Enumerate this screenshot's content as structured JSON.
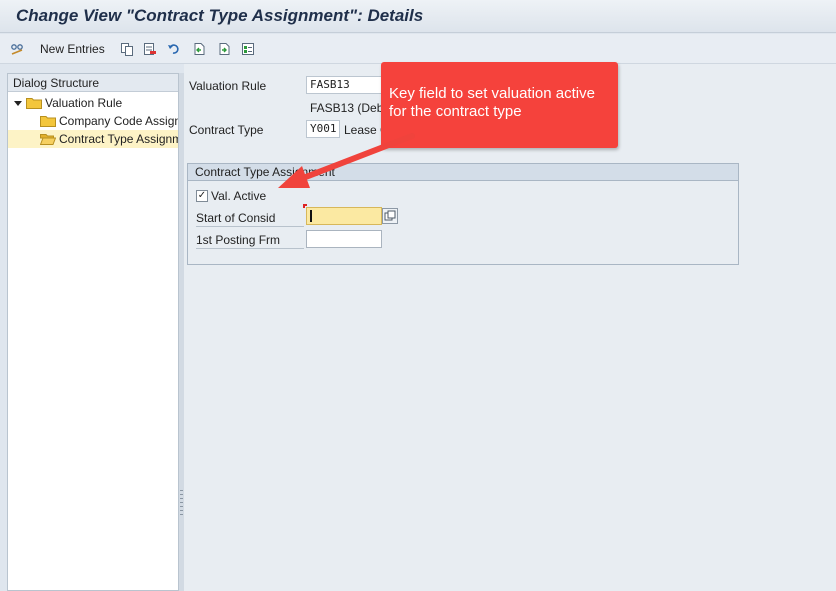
{
  "window": {
    "title": "Change View \"Contract Type Assignment\": Details"
  },
  "toolbar": {
    "new_entries_label": "New Entries",
    "icons": [
      "display-change-icon",
      "copy-icon",
      "delete-icon",
      "undo-icon",
      "previous-entry-icon",
      "next-entry-icon",
      "select-all-icon"
    ]
  },
  "dialog_structure": {
    "header": "Dialog Structure",
    "items": [
      {
        "label": "Valuation Rule",
        "expanded": true,
        "selected": false
      },
      {
        "label": "Company Code Assignment",
        "selected": false
      },
      {
        "label": "Contract Type Assignment",
        "selected": true
      }
    ]
  },
  "header_fields": {
    "valuation_rule": {
      "label": "Valuation Rule",
      "value": "FASB13",
      "description": "FASB13 (Debt"
    },
    "contract_type": {
      "label": "Contract Type",
      "value": "Y001",
      "description": "Lease C"
    }
  },
  "group": {
    "title": "Contract Type Assignment",
    "val_active": {
      "label": "Val. Active",
      "checked": true
    },
    "start_of_consid": {
      "label": "Start of Consid",
      "value": ""
    },
    "first_posting": {
      "label": "1st Posting Frm",
      "value": ""
    }
  },
  "callout": {
    "text": "Key field to set valuation active for the contract type"
  },
  "colors": {
    "callout": "#f5423c",
    "required_field": "#fbe9a2",
    "selected_row": "#fdf3c6"
  }
}
